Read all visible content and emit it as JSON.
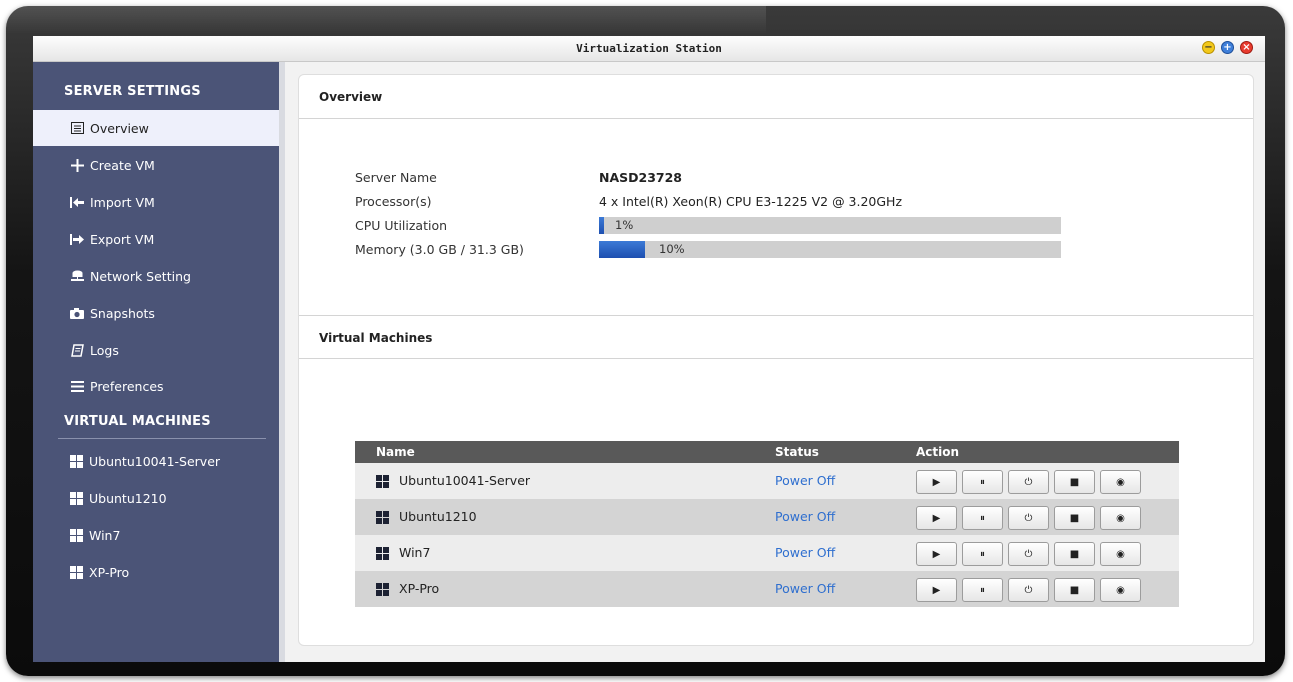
{
  "window": {
    "title": "Virtualization Station"
  },
  "window_controls": [
    "minimize-icon",
    "maximize-icon",
    "close-icon"
  ],
  "sidebar": {
    "server_heading": "SERVER SETTINGS",
    "items": [
      {
        "label": "Overview",
        "icon": "overview-icon",
        "active": true
      },
      {
        "label": "Create VM",
        "icon": "plus-icon"
      },
      {
        "label": "Import VM",
        "icon": "import-icon"
      },
      {
        "label": "Export VM",
        "icon": "export-icon"
      },
      {
        "label": "Network Setting",
        "icon": "network-icon"
      },
      {
        "label": "Snapshots",
        "icon": "camera-icon"
      },
      {
        "label": "Logs",
        "icon": "logs-icon"
      },
      {
        "label": "Preferences",
        "icon": "preferences-icon"
      }
    ],
    "vm_heading": "VIRTUAL MACHINES",
    "vms": [
      {
        "label": "Ubuntu10041-Server"
      },
      {
        "label": "Ubuntu1210"
      },
      {
        "label": "Win7"
      },
      {
        "label": "XP-Pro"
      }
    ]
  },
  "overview": {
    "heading": "Overview",
    "server_name_label": "Server Name",
    "server_name": "NASD23728",
    "processor_label": "Processor(s)",
    "processor": "4 x Intel(R) Xeon(R) CPU E3-1225 V2 @ 3.20GHz",
    "cpu_label": "CPU Utilization",
    "cpu_text": "1%",
    "cpu_fraction": 0.01,
    "memory_label": "Memory (3.0 GB / 31.3 GB)",
    "memory_text": "10%",
    "memory_fraction": 0.1
  },
  "virtual_machines": {
    "heading": "Virtual Machines",
    "columns": {
      "name": "Name",
      "status": "Status",
      "action": "Action"
    },
    "rows": [
      {
        "name": "Ubuntu10041-Server",
        "status": "Power Off"
      },
      {
        "name": "Ubuntu1210",
        "status": "Power Off"
      },
      {
        "name": "Win7",
        "status": "Power Off"
      },
      {
        "name": "XP-Pro",
        "status": "Power Off"
      }
    ],
    "actions": [
      {
        "name": "start-button",
        "icon": "play-icon",
        "glyph": "▶"
      },
      {
        "name": "pause-button",
        "icon": "pause-icon",
        "glyph": "⏸"
      },
      {
        "name": "power-button",
        "icon": "power-icon",
        "glyph": "⏻"
      },
      {
        "name": "stop-button",
        "icon": "stop-icon",
        "glyph": "■"
      },
      {
        "name": "view-button",
        "icon": "eye-icon",
        "glyph": "◉"
      }
    ]
  },
  "colors": {
    "sidebar_bg": "#4b5477",
    "active_item_bg": "#eef0fb",
    "status_text": "#2f6fcf",
    "bar_fill": "#2a61c4",
    "table_header": "#595959"
  }
}
